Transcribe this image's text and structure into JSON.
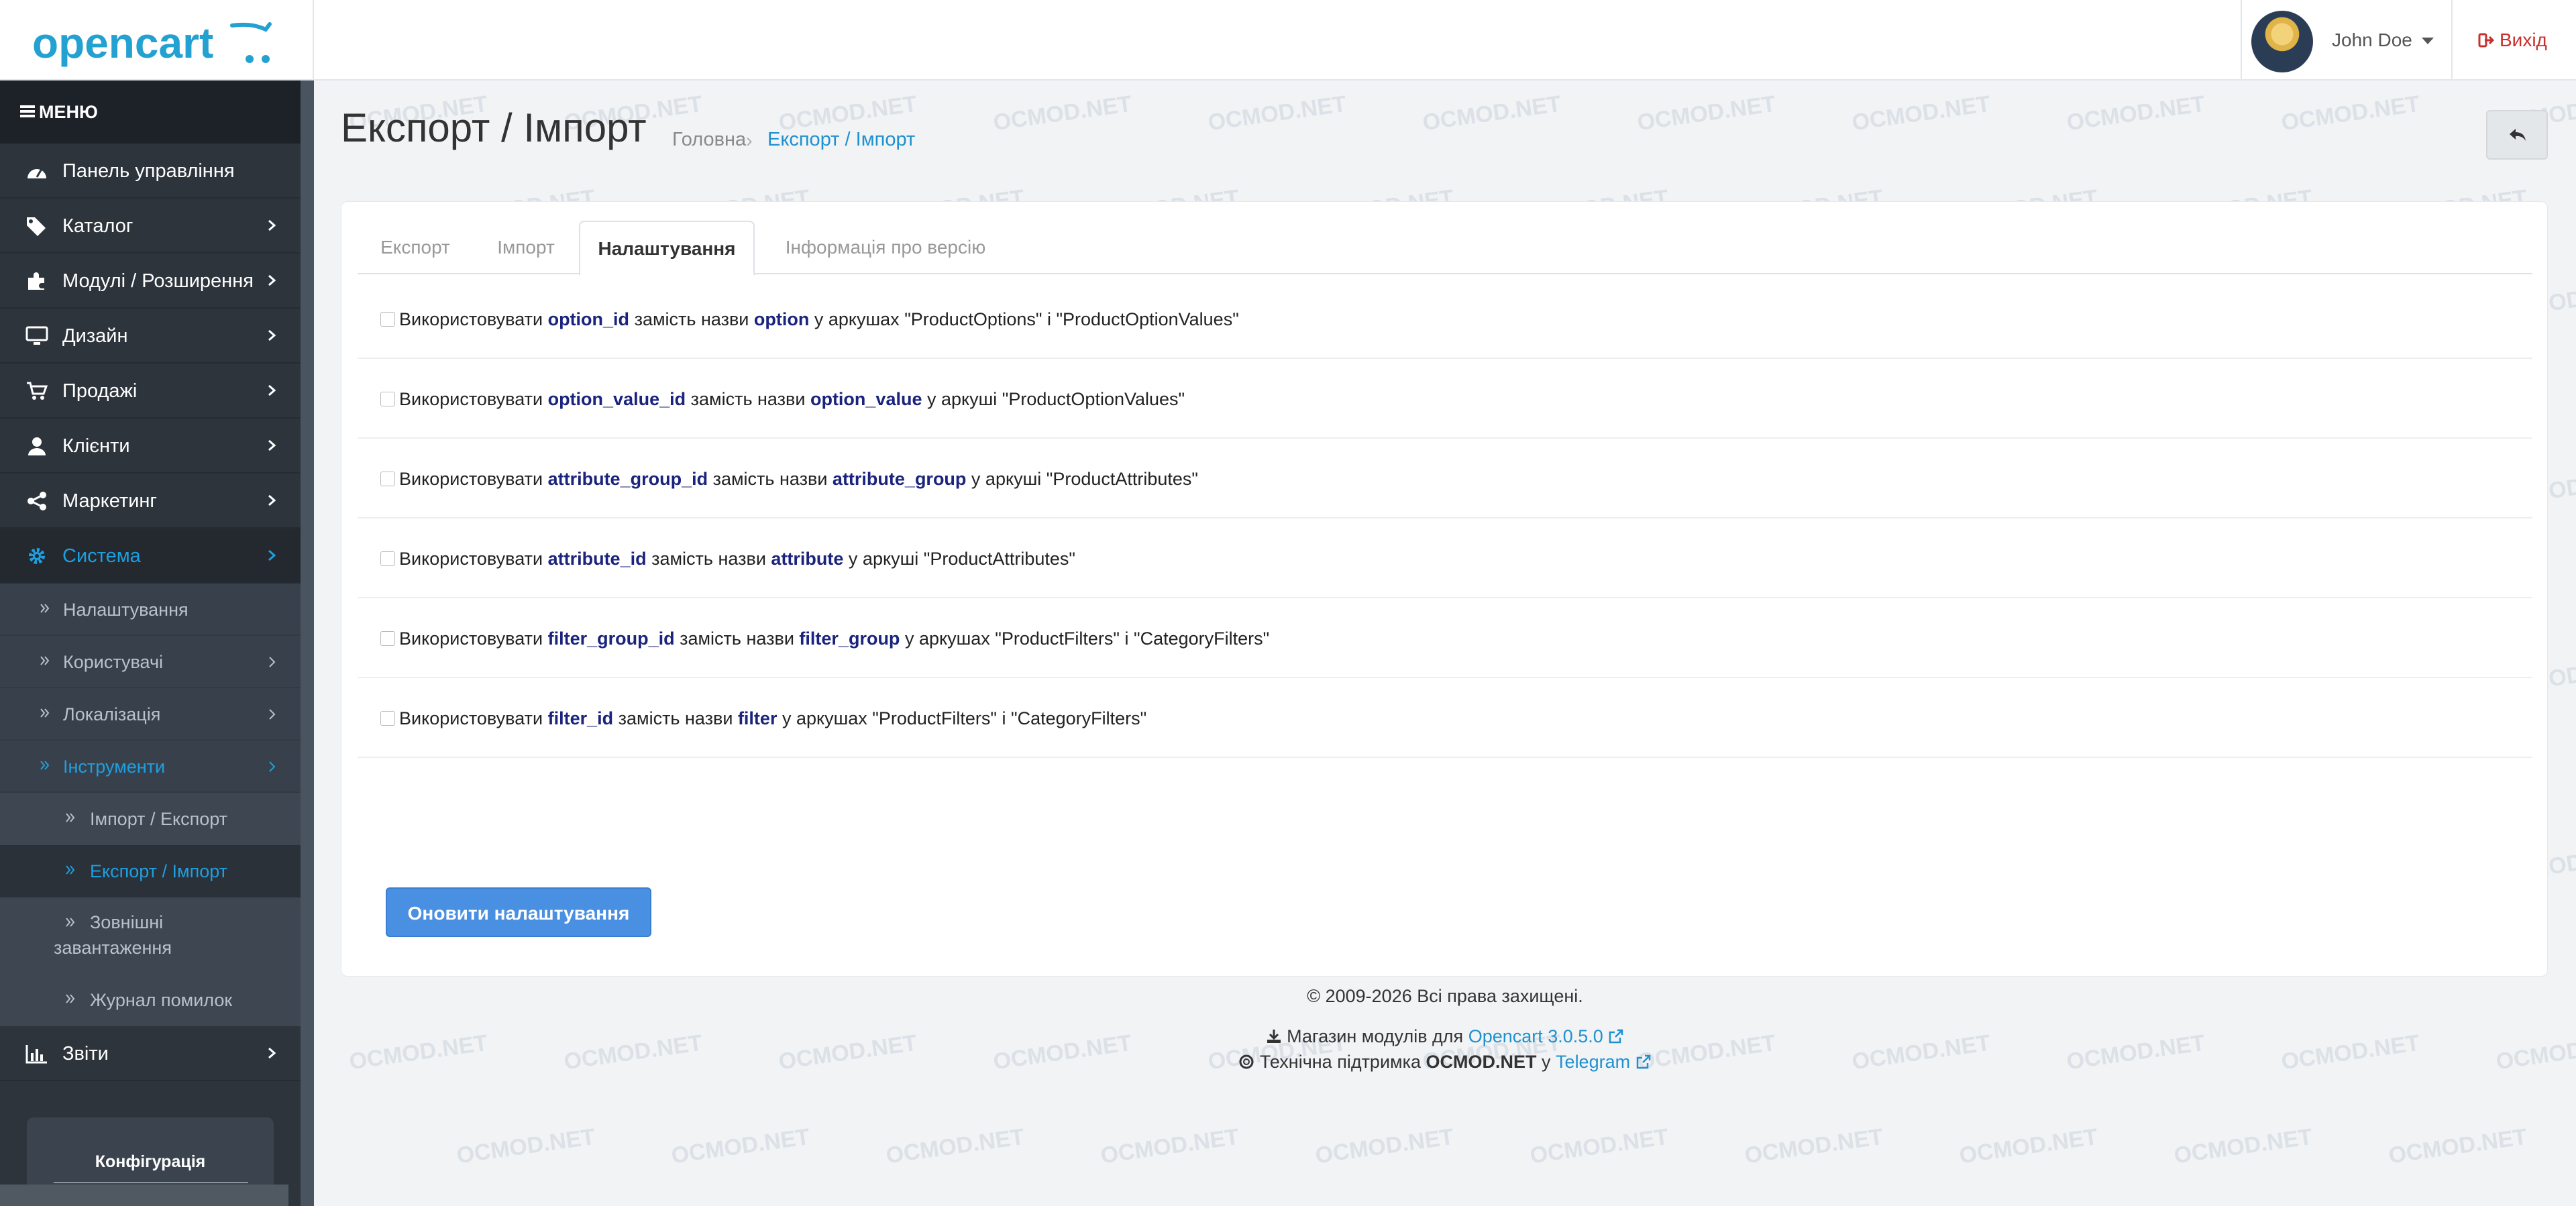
{
  "brand": {
    "logo_text": "opencart"
  },
  "header": {
    "user_name": "John Doe",
    "logout_label": "Вихід"
  },
  "sidebar": {
    "menu_label": "МЕНЮ",
    "items": [
      {
        "label": "Панель управління"
      },
      {
        "label": "Каталог"
      },
      {
        "label": "Модулі / Розширення"
      },
      {
        "label": "Дизайн"
      },
      {
        "label": "Продажі"
      },
      {
        "label": "Клієнти"
      },
      {
        "label": "Маркетинг"
      },
      {
        "label": "Система"
      },
      {
        "label": "Звіти"
      }
    ],
    "system_sub": [
      {
        "label": "Налаштування"
      },
      {
        "label": "Користувачі"
      },
      {
        "label": "Локалізація"
      },
      {
        "label": "Інструменти"
      }
    ],
    "tools_sub": [
      {
        "label": "Імпорт / Експорт"
      },
      {
        "label": "Експорт / Імпорт"
      },
      {
        "label_line1": "Зовнішні",
        "label_line2": "завантаження"
      },
      {
        "label": "Журнал помилок"
      }
    ],
    "config_label": "Конфігурація"
  },
  "page": {
    "title": "Експорт / Імпорт",
    "breadcrumb_home": "Головна",
    "breadcrumb_current": "Експорт / Імпорт"
  },
  "tabs": [
    {
      "label": "Експорт"
    },
    {
      "label": "Імпорт"
    },
    {
      "label": "Налаштування"
    },
    {
      "label": "Інформація про версію"
    }
  ],
  "settings": [
    {
      "pre": "Використовувати ",
      "id": "option_id",
      "mid": " замість назви ",
      "name": "option",
      "post": " у аркушах \"ProductOptions\" і \"ProductOptionValues\""
    },
    {
      "pre": "Використовувати ",
      "id": "option_value_id",
      "mid": " замість назви ",
      "name": "option_value",
      "post": " у аркуші \"ProductOptionValues\""
    },
    {
      "pre": "Використовувати ",
      "id": "attribute_group_id",
      "mid": " замість назви ",
      "name": "attribute_group",
      "post": " у аркуші \"ProductAttributes\""
    },
    {
      "pre": "Використовувати ",
      "id": "attribute_id",
      "mid": " замість назви ",
      "name": "attribute",
      "post": " у аркуші \"ProductAttributes\""
    },
    {
      "pre": "Використовувати ",
      "id": "filter_group_id",
      "mid": " замість назви ",
      "name": "filter_group",
      "post": " у аркушах \"ProductFilters\" і \"CategoryFilters\""
    },
    {
      "pre": "Використовувати ",
      "id": "filter_id",
      "mid": " замість назви ",
      "name": "filter",
      "post": " у аркушах \"ProductFilters\" і \"CategoryFilters\""
    }
  ],
  "update_button": "Оновити налаштування",
  "footer": {
    "copyright": "© 2009-2026 Всі права захищені.",
    "store_prefix": "Магазин модулів для ",
    "store_link": "Opencart 3.0.5.0",
    "support_prefix": "Технічна підтримка ",
    "support_brand": "OCMOD.NET",
    "support_mid": " у ",
    "support_link": "Telegram"
  },
  "watermark": "OCMOD.NET",
  "colors": {
    "sidebar_bg": "#2d343c",
    "accent_blue": "#1e9fe0",
    "button_blue": "#4a90e2",
    "code_navy": "#1a237e",
    "logout_red": "#c9302c"
  }
}
